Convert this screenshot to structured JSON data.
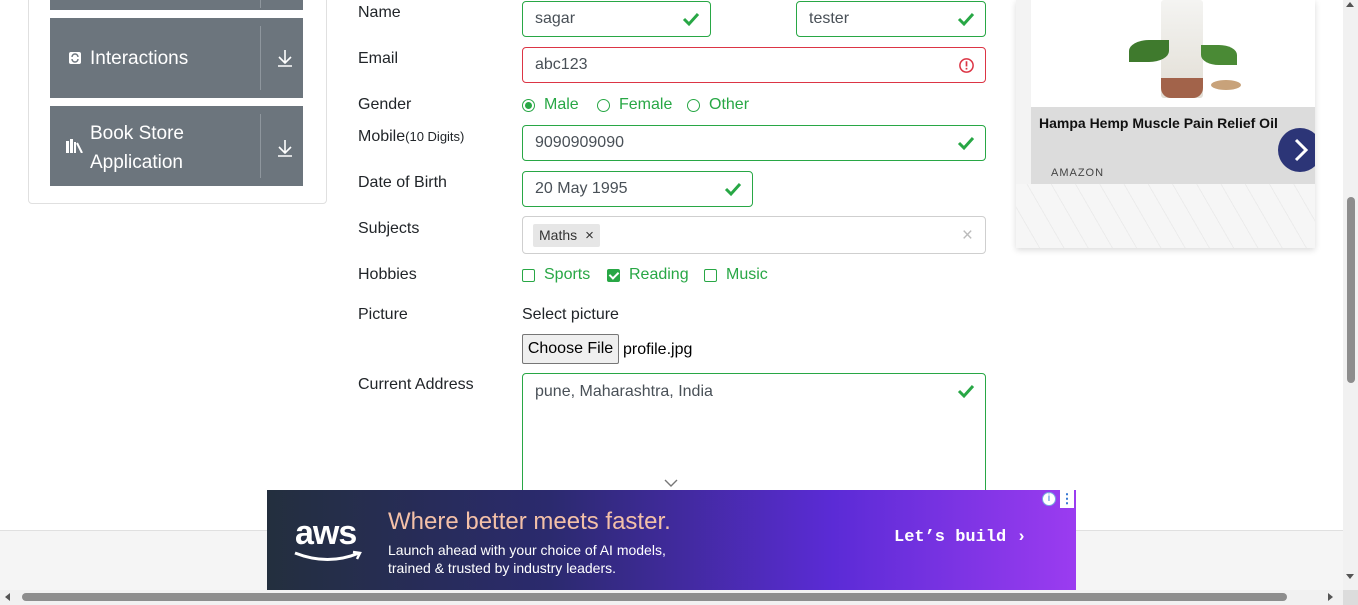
{
  "sidebar": {
    "groups": [
      {
        "label": "Interactions",
        "icon": "refresh-icon"
      },
      {
        "label": "Book Store Application",
        "line1": "Book Store",
        "line2": "Application",
        "icon": "books-icon"
      }
    ]
  },
  "form": {
    "name_label": "Name",
    "first_name": "sagar",
    "last_name": "tester",
    "email_label": "Email",
    "email_value": "abc123",
    "gender_label": "Gender",
    "gender_options": [
      "Male",
      "Female",
      "Other"
    ],
    "gender_selected": "Male",
    "mobile_label": "Mobile",
    "mobile_hint": "(10 Digits)",
    "mobile_value": "9090909090",
    "dob_label": "Date of Birth",
    "dob_value": "20 May 1995",
    "subjects_label": "Subjects",
    "subject_tag": "Maths",
    "subject_tag_remove": "×",
    "subjects_clear": "×",
    "hobbies_label": "Hobbies",
    "hobbies": [
      {
        "label": "Sports",
        "checked": false
      },
      {
        "label": "Reading",
        "checked": true
      },
      {
        "label": "Music",
        "checked": false
      }
    ],
    "picture_label": "Picture",
    "select_picture": "Select picture",
    "choose_file": "Choose File",
    "file_name": "profile.jpg",
    "address_label": "Current Address",
    "address_value": "pune, Maharashtra, India"
  },
  "ads": {
    "product": {
      "title": "Hampa Hemp Muscle Pain Relief Oil",
      "source": "AMAZON"
    },
    "aws": {
      "brand": "aws",
      "headline": "Where better meets faster.",
      "line1": "Launch ahead with your choice of AI models,",
      "line2": "trained & trusted by industry leaders.",
      "cta": "Let’s build ›"
    }
  },
  "colors": {
    "valid": "#28a745",
    "invalid": "#dc3545",
    "sidebar_group": "#6c757d",
    "ad_arrow": "#2c3577"
  }
}
